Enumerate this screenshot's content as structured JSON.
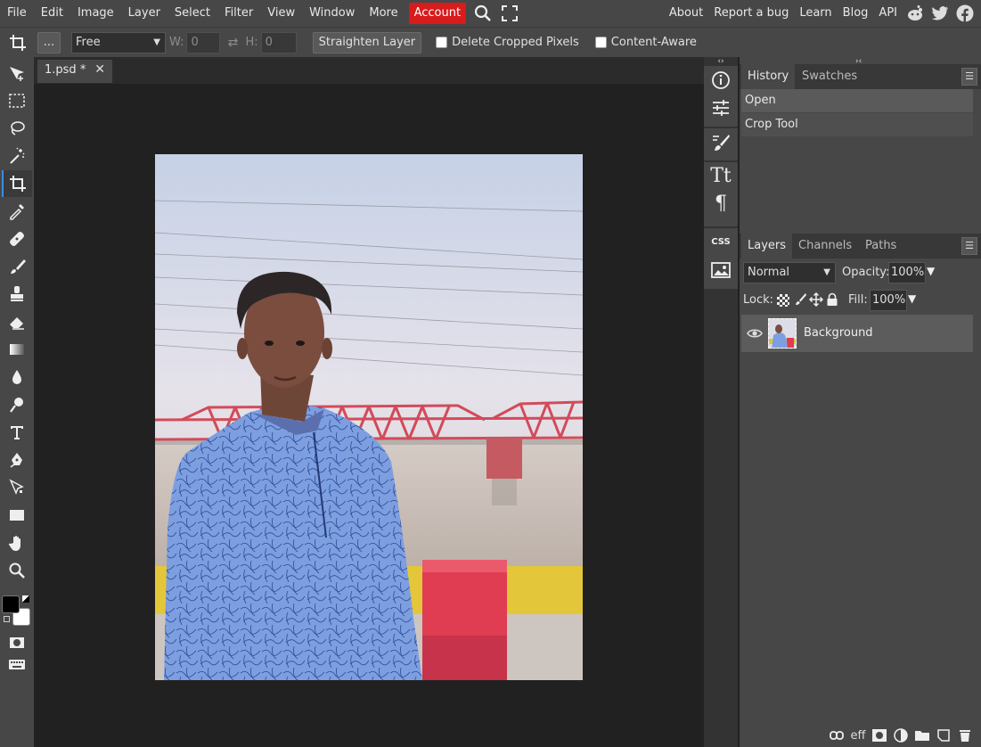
{
  "menu": {
    "items": [
      "File",
      "Edit",
      "Image",
      "Layer",
      "Select",
      "Filter",
      "View",
      "Window",
      "More"
    ],
    "account": "Account",
    "right_links": [
      "About",
      "Report a bug",
      "Learn",
      "Blog",
      "API"
    ]
  },
  "options": {
    "more": "...",
    "ratio": "Free",
    "w_label": "W:",
    "w_value": "0",
    "h_label": "H:",
    "h_value": "0",
    "straighten": "Straighten Layer",
    "delete_cropped": "Delete Cropped Pixels",
    "content_aware": "Content-Aware"
  },
  "document": {
    "tab": "1.psd *",
    "close": "✕"
  },
  "history_panel": {
    "tabs": [
      "History",
      "Swatches"
    ],
    "items": [
      "Open",
      "Crop Tool"
    ]
  },
  "layers_panel": {
    "tabs": [
      "Layers",
      "Channels",
      "Paths"
    ],
    "blend_mode": "Normal",
    "opacity_label": "Opacity:",
    "opacity_value": "100%",
    "lock_label": "Lock:",
    "fill_label": "Fill:",
    "fill_value": "100%",
    "layers": [
      {
        "name": "Background"
      }
    ],
    "bottom_eff": "eff"
  },
  "strip": {
    "css": "CSS"
  },
  "colors": {
    "accent": "#3c8ce0",
    "account": "#d81b1b",
    "foreground": "#000000",
    "background": "#ffffff"
  }
}
